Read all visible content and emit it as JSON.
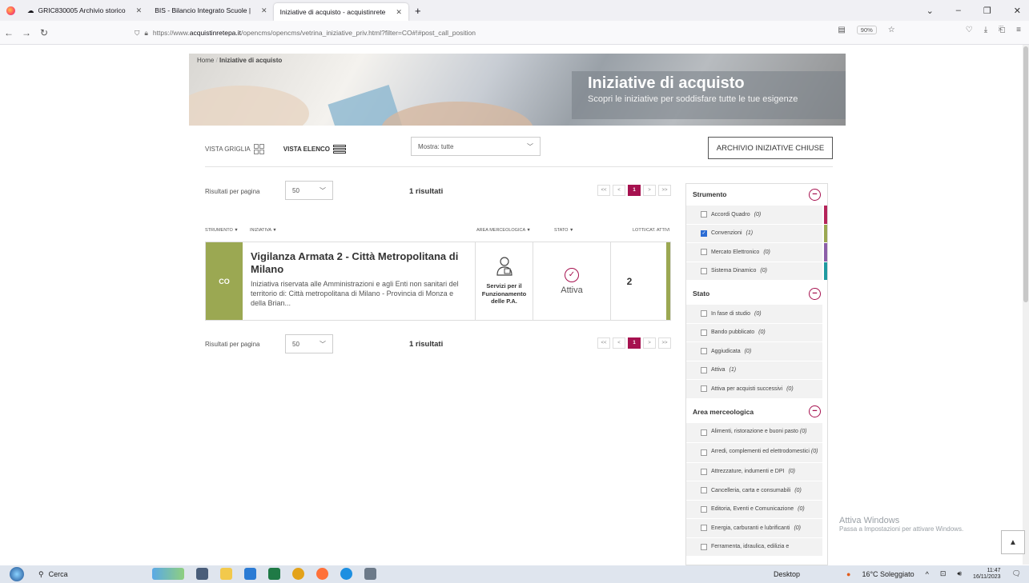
{
  "browser": {
    "tabs": [
      {
        "label": "GRIC830005 Archivio storico",
        "active": false
      },
      {
        "label": "BIS - Bilancio Integrato Scuole |",
        "active": false
      },
      {
        "label": "Iniziative di acquisto - acquistinrete",
        "active": true
      }
    ],
    "url_prefix": "https://www.",
    "url_domain": "acquistinretepa.it",
    "url_path": "/opencms/opencms/vetrina_iniziative_priv.html?filter=CO#!#post_call_position",
    "zoom": "90%"
  },
  "page": {
    "breadcrumb_home": "Home",
    "breadcrumb_current": "Iniziative di acquisto",
    "hero_title": "Iniziative di acquisto",
    "hero_subtitle": "Scopri le iniziative per soddisfare tutte le tue esigenze",
    "vista_griglia": "VISTA GRIGLIA",
    "vista_elenco": "VISTA ELENCO",
    "mostra": "Mostra: tutte",
    "archivio": "ARCHIVIO INIZIATIVE CHIUSE",
    "rpp_label": "Risultati per pagina",
    "rpp_value": "50",
    "results": "1 risultati",
    "pager": [
      "<<",
      "<",
      "1",
      ">",
      ">>"
    ],
    "columns": {
      "strumento": "STRUMENTO ▼",
      "iniziativa": "INIZIATIVA ▼",
      "area": "AREA MERCEOLOGICA ▼",
      "stato": "STATO ▼",
      "lotti": "LOTTI/CAT. ATTIVI"
    },
    "item": {
      "tag": "CO",
      "title": "Vigilanza Armata 2 - Città Metropolitana di Milano",
      "description": "Iniziativa riservata alle Amministrazioni e agli Enti non sanitari del territorio di: Città metropolitana di Milano - Provincia di Monza e della Brian...",
      "area": "Servizi per il Funzionamento delle P.A.",
      "stato": "Attiva",
      "lotti": "2"
    }
  },
  "filters": {
    "strumento": {
      "title": "Strumento",
      "items": [
        {
          "label": "Accordi Quadro",
          "count": "(0)",
          "checked": false,
          "color": "#b5245a"
        },
        {
          "label": "Convenzioni",
          "count": "(1)",
          "checked": true,
          "color": "#9ba852"
        },
        {
          "label": "Mercato Elettronico",
          "count": "(0)",
          "checked": false,
          "color": "#8c5fa8"
        },
        {
          "label": "Sistema Dinamico",
          "count": "(0)",
          "checked": false,
          "color": "#1e9aa0"
        }
      ]
    },
    "stato": {
      "title": "Stato",
      "items": [
        {
          "label": "In fase di studio",
          "count": "(0)"
        },
        {
          "label": "Bando pubblicato",
          "count": "(0)"
        },
        {
          "label": "Aggiudicata",
          "count": "(0)"
        },
        {
          "label": "Attiva",
          "count": "(1)"
        },
        {
          "label": "Attiva per acquisti successivi",
          "count": "(0)"
        }
      ]
    },
    "area": {
      "title": "Area merceologica",
      "items": [
        {
          "label": "Alimenti, ristorazione e buoni pasto",
          "count": "(0)"
        },
        {
          "label": "Arredi, complementi ed elettrodomestici",
          "count": "(0)"
        },
        {
          "label": "Attrezzature, indumenti e DPI",
          "count": "(0)"
        },
        {
          "label": "Cancelleria, carta e consumabili",
          "count": "(0)"
        },
        {
          "label": "Editoria, Eventi e Comunicazione",
          "count": "(0)"
        },
        {
          "label": "Energia, carburanti e lubrificanti",
          "count": "(0)"
        },
        {
          "label": "Ferramenta, idraulica, edilizia e",
          "count": ""
        }
      ]
    }
  },
  "os": {
    "watermark_title": "Attiva Windows",
    "watermark_sub": "Passa a Impostazioni per attivare Windows.",
    "search": "Cerca",
    "desktop": "Desktop",
    "weather": "16°C Soleggiato",
    "time": "11:47",
    "date": "16/11/2023"
  }
}
